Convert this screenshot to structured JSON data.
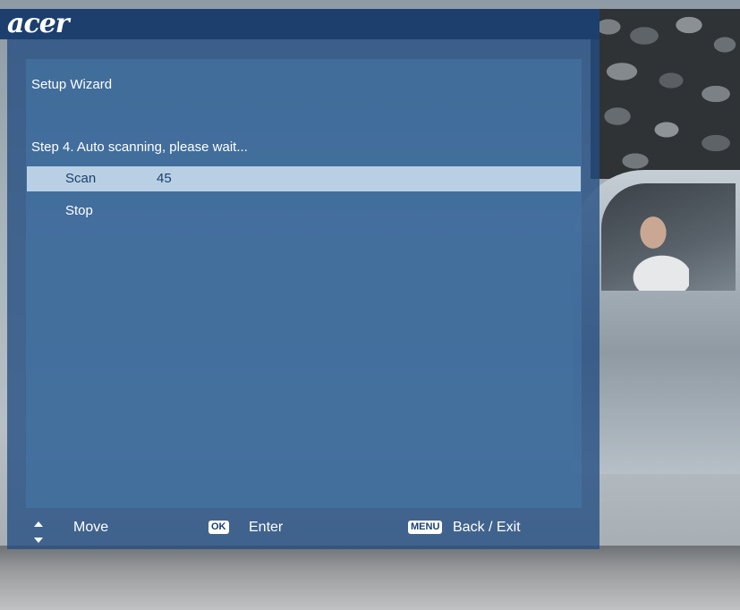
{
  "brand": {
    "logo_text": "acer"
  },
  "wizard": {
    "title": "Setup Wizard",
    "step": "Step 4. Auto scanning, please wait...",
    "rows": [
      {
        "label": "Scan",
        "value": "45",
        "selected": true
      },
      {
        "label": "Stop",
        "value": "",
        "selected": false
      }
    ]
  },
  "hints": {
    "move": "Move",
    "ok_key": "OK",
    "enter": "Enter",
    "menu_key": "MENU",
    "back_exit": "Back / Exit"
  },
  "colors": {
    "topbar": "#1c3f6e",
    "panel": "#224d82",
    "selected_row": "#b9d0e4",
    "text": "#ffffff"
  }
}
